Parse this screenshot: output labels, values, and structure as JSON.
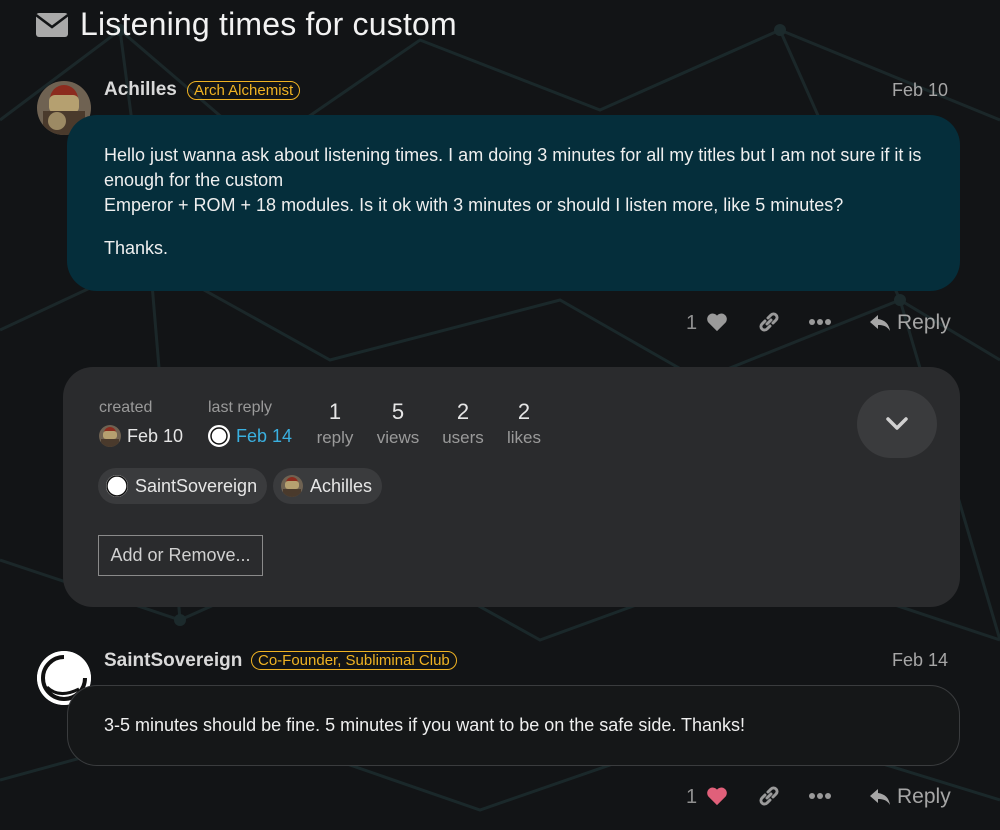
{
  "topic": {
    "title": "Listening times for custom",
    "icon": "envelope-icon"
  },
  "posts": [
    {
      "username": "Achilles",
      "badge": "Arch Alchemist",
      "date": "Feb 10",
      "paragraphs": [
        "Hello just wanna ask about listening times. I am doing 3 minutes for all my titles but I am not sure if it is enough for the custom",
        "Emperor + ROM + 18 modules. Is it ok with 3 minutes or should I listen more, like 5 minutes?",
        "Thanks."
      ],
      "likes": "1",
      "reply_label": "Reply"
    },
    {
      "username": "SaintSovereign",
      "badge": "Co-Founder, Subliminal Club",
      "date": "Feb 14",
      "paragraphs": [
        "3-5 minutes should be fine. 5 minutes if you want to be on the safe side. Thanks!"
      ],
      "likes": "1",
      "reply_label": "Reply"
    }
  ],
  "topic_map": {
    "created_label": "created",
    "created_date": "Feb 10",
    "last_reply_label": "last reply",
    "last_reply_date": "Feb 14",
    "stats": [
      {
        "value": "1",
        "label": "reply"
      },
      {
        "value": "5",
        "label": "views"
      },
      {
        "value": "2",
        "label": "users"
      },
      {
        "value": "2",
        "label": "likes"
      }
    ],
    "participants": [
      "SaintSovereign",
      "Achilles"
    ],
    "add_remove_label": "Add or Remove..."
  },
  "colors": {
    "background": "#121416",
    "post_bubble": "#052e3b",
    "badge": "#f0b323",
    "link": "#3ab0e0",
    "liked_heart": "#e0607a"
  }
}
